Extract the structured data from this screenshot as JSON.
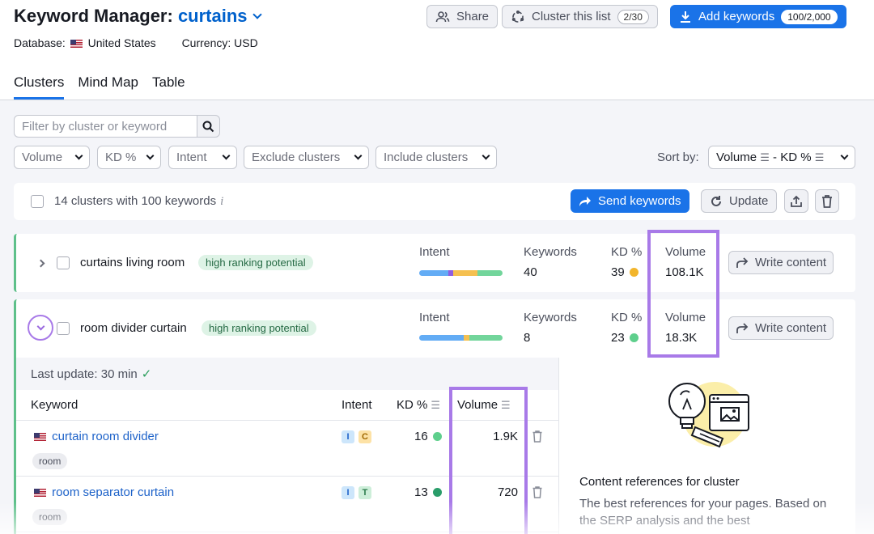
{
  "header": {
    "title_prefix": "Keyword Manager: ",
    "project": "curtains",
    "database_label": "Database:",
    "database_value": "United States",
    "currency": "Currency: USD",
    "share_label": "Share",
    "cluster_label": "Cluster this list",
    "cluster_count": "2/30",
    "add_label": "Add keywords",
    "add_count": "100/2,000"
  },
  "tabs": [
    {
      "label": "Clusters",
      "active": true
    },
    {
      "label": "Mind Map",
      "active": false
    },
    {
      "label": "Table",
      "active": false
    }
  ],
  "filters": {
    "search_placeholder": "Filter by cluster or keyword",
    "dropdowns": [
      "Volume",
      "KD %",
      "Intent",
      "Exclude clusters",
      "Include clusters"
    ],
    "sort_label": "Sort by:",
    "sort_value": "Volume",
    "sort_value2": "- KD %"
  },
  "toolbar": {
    "summary": "14 clusters with 100 keywords",
    "info": "i",
    "send_label": "Send keywords",
    "update_label": "Update"
  },
  "columns": {
    "intent": "Intent",
    "keywords": "Keywords",
    "kd": "KD %",
    "volume": "Volume",
    "write": "Write content"
  },
  "clusters": [
    {
      "name": "curtains living room",
      "tag": "high ranking potential",
      "keywords": "40",
      "kd": "39",
      "kd_color": "#f2b52b",
      "volume": "108.1K",
      "expanded": false
    },
    {
      "name": "room divider curtain",
      "tag": "high ranking potential",
      "keywords": "8",
      "kd": "23",
      "kd_color": "#5ecf8c",
      "volume": "18.3K",
      "expanded": true
    }
  ],
  "detail": {
    "last_update": "Last update: 30 min",
    "headers": {
      "keyword": "Keyword",
      "intent": "Intent",
      "kd": "KD %",
      "volume": "Volume"
    },
    "rows": [
      {
        "keyword": "curtain room divider",
        "tag": "room",
        "intents": [
          "I",
          "C"
        ],
        "kd": "16",
        "kd_color": "#5ecf8c",
        "volume": "1.9K"
      },
      {
        "keyword": "room separator curtain",
        "tag": "room",
        "intents": [
          "I",
          "T"
        ],
        "kd": "13",
        "kd_color": "#2a9d6a",
        "volume": "720"
      }
    ],
    "side_title": "Content references for cluster",
    "side_desc": "The best references for your pages. Based on the SERP analysis and the best"
  },
  "colors": {
    "accent": "#1a73e8",
    "highlight": "#a87ae8",
    "cluster_border": "#5ec08a"
  }
}
